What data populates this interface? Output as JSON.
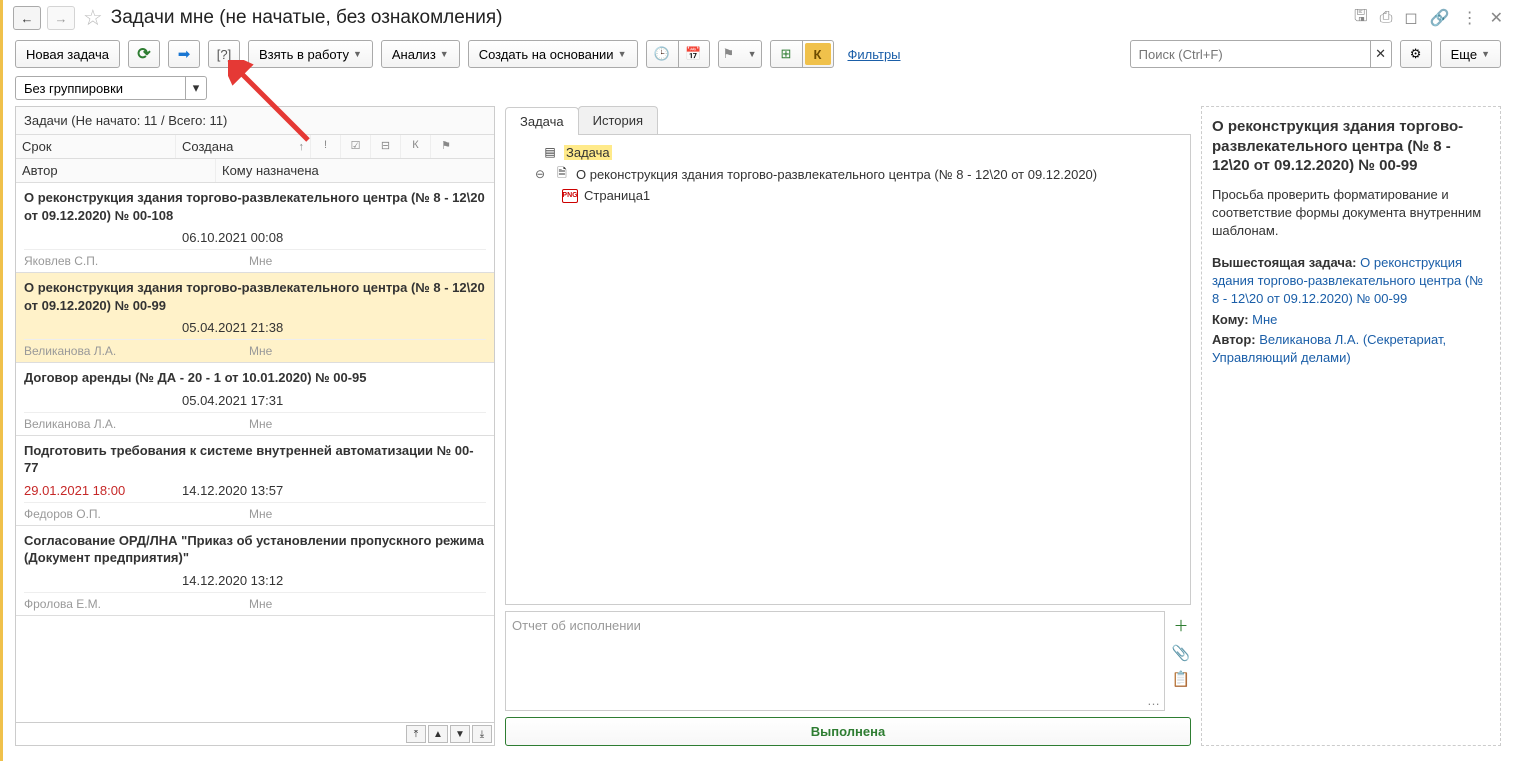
{
  "titlebar": {
    "title": "Задачи мне (не начатые, без ознакомления)"
  },
  "toolbar": {
    "new_task": "Новая задача",
    "take_to_work": "Взять в работу",
    "analysis": "Анализ",
    "create_based_on": "Создать на основании",
    "filters": "Фильтры",
    "search_placeholder": "Поиск (Ctrl+F)",
    "more": "Еще"
  },
  "grouping": {
    "value": "Без группировки"
  },
  "tasklist": {
    "summary": "Задачи (Не начато: 11 / Всего: 11)",
    "headers": {
      "srok": "Срок",
      "created": "Создана",
      "author": "Автор",
      "whom": "Кому назначена",
      "k": "К"
    },
    "items": [
      {
        "title": "О реконструкция здания торгово-развлекательного центра (№ 8 - 12\\20 от 09.12.2020) № 00-108",
        "due": "",
        "created": "06.10.2021 00:08",
        "author": "Яковлев С.П.",
        "whom": "Мне",
        "selected": false
      },
      {
        "title": "О реконструкция здания торгово-развлекательного центра (№ 8 - 12\\20 от 09.12.2020) № 00-99",
        "due": "",
        "created": "05.04.2021 21:38",
        "author": "Великанова Л.А.",
        "whom": "Мне",
        "selected": true
      },
      {
        "title": "Договор аренды (№ ДА - 20 - 1 от 10.01.2020) № 00-95",
        "due": "",
        "created": "05.04.2021 17:31",
        "author": "Великанова Л.А.",
        "whom": "Мне",
        "selected": false
      },
      {
        "title": "Подготовить требования к системе внутренней автоматизации № 00-77",
        "due": "29.01.2021 18:00",
        "due_red": true,
        "created": "14.12.2020 13:57",
        "author": "Федоров О.П.",
        "whom": "Мне",
        "selected": false
      },
      {
        "title": "Согласование ОРД/ЛНА \"Приказ об установлении пропускного режима (Документ предприятия)\"",
        "due": "",
        "created": "14.12.2020 13:12",
        "author": "Фролова Е.М.",
        "whom": "Мне",
        "selected": false
      }
    ]
  },
  "mid": {
    "tab_task": "Задача",
    "tab_history": "История",
    "tree": {
      "root": "Задача",
      "doc": "О реконструкция здания торгово-развлекательного центра (№ 8 - 12\\20 от 09.12.2020)",
      "page": "Страница1"
    },
    "report_placeholder": "Отчет об исполнении",
    "done": "Выполнена"
  },
  "right": {
    "title": "О реконструкция здания торгово-развлекательного центра (№ 8 - 12\\20 от 09.12.2020) № 00-99",
    "body": "Просьба проверить форматирование и соответствие формы документа внутренним шаблонам.",
    "parent_label": "Вышестоящая задача:",
    "parent_link": "О реконструкция здания торгово-развлекательного центра (№ 8 - 12\\20 от 09.12.2020) № 00-99",
    "whom_label": "Кому:",
    "whom_link": "Мне",
    "author_label": "Автор:",
    "author_link": "Великанова Л.А. (Секретариат, Управляющий делами)"
  }
}
